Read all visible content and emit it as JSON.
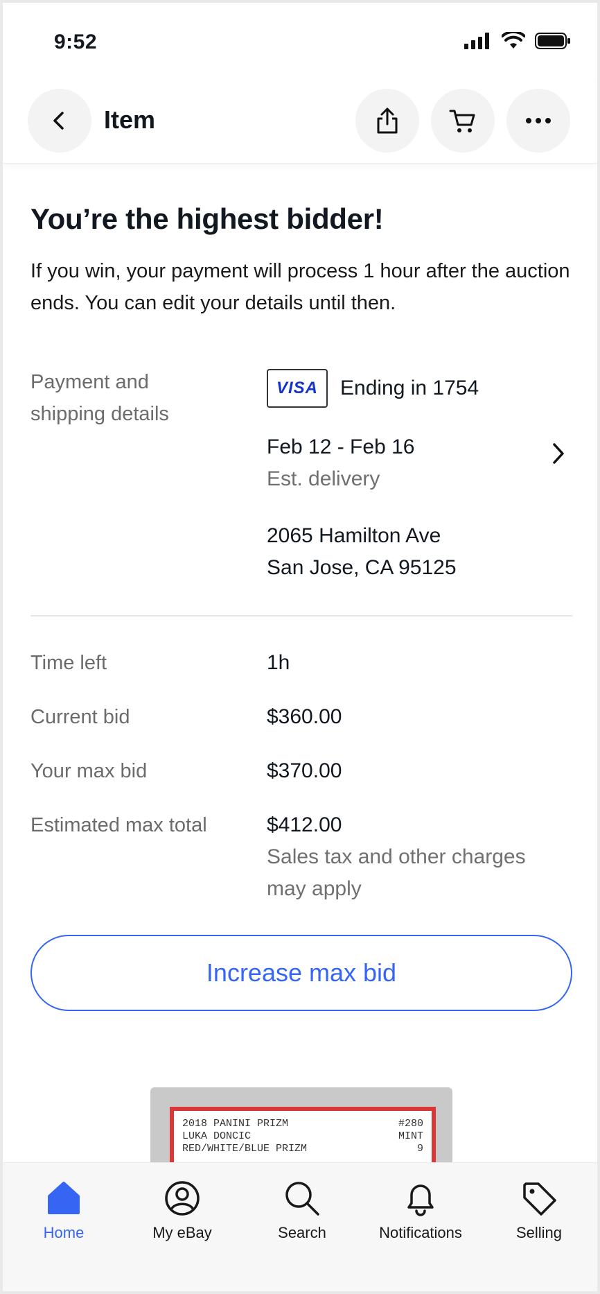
{
  "status_bar": {
    "time": "9:52"
  },
  "header": {
    "title": "Item"
  },
  "main": {
    "headline": "You’re the highest bidder!",
    "subtext": "If you win, your payment will process 1 hour after the auction ends. You can edit your details until then.",
    "payment": {
      "label_line1": "Payment and",
      "label_line2": "shipping details",
      "card_brand": "VISA",
      "card_ending": "Ending in 1754",
      "delivery_dates": "Feb 12 - Feb 16",
      "delivery_label": "Est. delivery",
      "address_line1": "2065 Hamilton Ave",
      "address_line2": "San Jose, CA 95125"
    },
    "bid_details": [
      {
        "label": "Time left",
        "value": "1h"
      },
      {
        "label": "Current bid",
        "value": "$360.00"
      },
      {
        "label": "Your max bid",
        "value": "$370.00"
      },
      {
        "label": "Estimated max total",
        "value": "$412.00"
      }
    ],
    "tax_note_line1": "Sales tax and other charges",
    "tax_note_line2": "may apply",
    "cta_label": "Increase max bid",
    "card_preview": {
      "line1_left": "2018 PANINI PRIZM",
      "line1_right": "#280",
      "line2_left": "LUKA DONCIC",
      "line2_right": "MINT",
      "line3_left": "RED/WHITE/BLUE PRIZM",
      "line3_right": "9"
    }
  },
  "bottom_nav": {
    "items": [
      {
        "label": "Home",
        "icon": "home-icon",
        "active": true
      },
      {
        "label": "My eBay",
        "icon": "user-circle-icon",
        "active": false
      },
      {
        "label": "Search",
        "icon": "search-icon",
        "active": false
      },
      {
        "label": "Notifications",
        "icon": "bell-icon",
        "active": false
      },
      {
        "label": "Selling",
        "icon": "tag-icon",
        "active": false
      }
    ]
  },
  "colors": {
    "accent": "#3665f3",
    "visa_blue": "#1434cb",
    "muted_text": "#6b6b6b"
  }
}
